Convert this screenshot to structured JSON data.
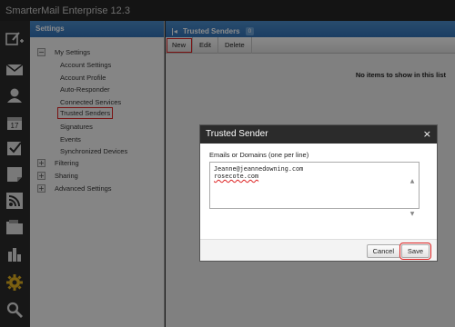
{
  "app": {
    "title": "SmarterMail Enterprise 12.3"
  },
  "iconbar": {
    "icons": [
      "compose-icon",
      "mail-icon",
      "contacts-icon",
      "calendar-icon",
      "tasks-icon",
      "notes-icon",
      "rss-icon",
      "files-icon",
      "reports-icon",
      "settings-gear-icon",
      "search-icon"
    ]
  },
  "settings": {
    "title": "Settings",
    "root_label": "My Settings",
    "items": [
      {
        "label": "Account Settings"
      },
      {
        "label": "Account Profile"
      },
      {
        "label": "Auto-Responder"
      },
      {
        "label": "Connected Services"
      },
      {
        "label": "Trusted Senders"
      },
      {
        "label": "Signatures"
      },
      {
        "label": "Events"
      },
      {
        "label": "Synchronized Devices"
      }
    ],
    "groups": [
      {
        "label": "Filtering"
      },
      {
        "label": "Sharing"
      },
      {
        "label": "Advanced Settings"
      }
    ]
  },
  "main": {
    "title": "Trusted Senders",
    "count": "0",
    "toolbar": {
      "new_label": "New",
      "edit_label": "Edit",
      "delete_label": "Delete"
    },
    "empty_message": "No items to show in this list"
  },
  "dialog": {
    "title": "Trusted Sender",
    "close_glyph": "×",
    "field_label": "Emails or Domains (one per line)",
    "line1": "Jeanne@jeannedowning.com",
    "line2": "rosecote.com",
    "cancel_label": "Cancel",
    "save_label": "Save"
  },
  "colors": {
    "accent": "#3a7bbf",
    "highlight": "#dd2222",
    "gear": "#e0b020"
  }
}
